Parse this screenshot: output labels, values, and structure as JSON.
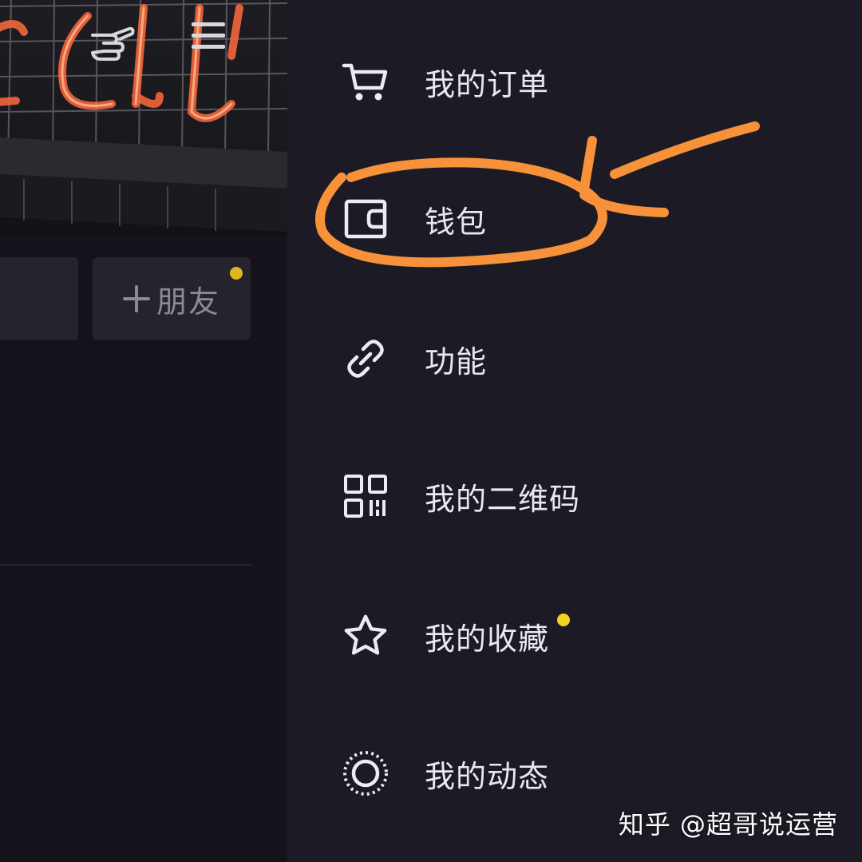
{
  "profile_page": {
    "add_friend_label": "朋友",
    "add_friend_has_badge": true
  },
  "drawer": {
    "items": [
      {
        "label": "我的订单",
        "icon": "cart-icon",
        "badge": false
      },
      {
        "label": "钱包",
        "icon": "wallet-icon",
        "badge": false,
        "highlighted": true
      },
      {
        "label": "功能",
        "icon": "link-icon",
        "badge": false
      },
      {
        "label": "我的二维码",
        "icon": "qr-code-icon",
        "badge": false
      },
      {
        "label": "我的收藏",
        "icon": "star-icon",
        "badge": true
      },
      {
        "label": "我的动态",
        "icon": "moments-icon",
        "badge": false
      }
    ]
  },
  "watermark": "知乎 @超哥说运营",
  "colors": {
    "drawer_bg": "#1c1b25",
    "page_bg": "#141219",
    "menu_text": "#e9e8ee",
    "annotation": "#f7923a",
    "badge": "#f2d321"
  }
}
